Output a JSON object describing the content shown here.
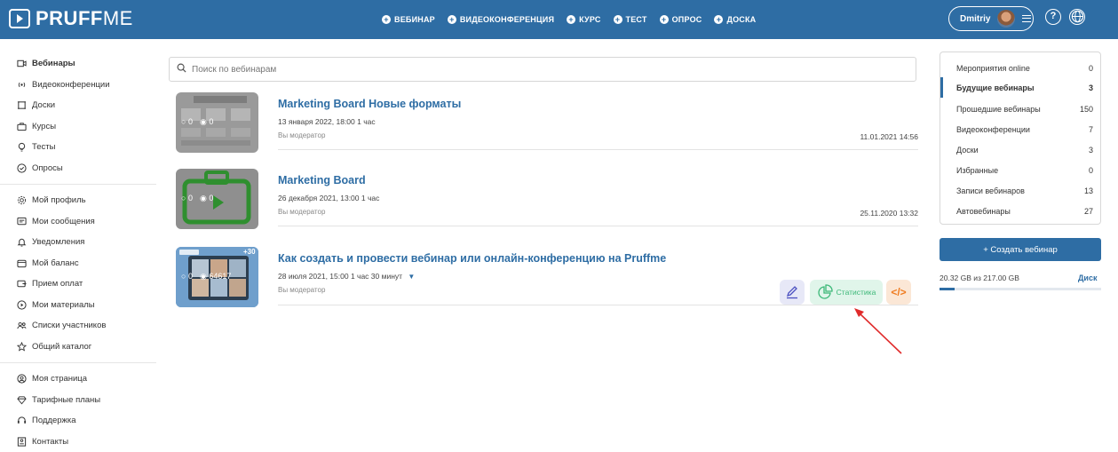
{
  "header": {
    "logo_bold": "PRUFF",
    "logo_light": "ME",
    "nav": [
      "ВЕБИНАР",
      "ВИДЕОКОНФЕРЕНЦИЯ",
      "КУРС",
      "ТЕСТ",
      "ОПРОС",
      "ДОСКА"
    ],
    "user_name": "Dmitriy",
    "help_icon": "question-circle-icon",
    "language_icon": "globe-icon"
  },
  "sidebar": {
    "group1": [
      "Вебинары",
      "Видеоконференции",
      "Доски",
      "Курсы",
      "Тесты",
      "Опросы"
    ],
    "group2": [
      "Мой профиль",
      "Мои сообщения",
      "Уведомления",
      "Мой баланс",
      "Прием оплат",
      "Мои материалы",
      "Списки участников",
      "Общий каталог"
    ],
    "group3": [
      "Моя страница",
      "Тарифные планы",
      "Поддержка",
      "Контакты"
    ]
  },
  "search": {
    "placeholder": "Поиск по вебинарам"
  },
  "webinars": [
    {
      "title": "Marketing Board Новые форматы",
      "meta": "13 января 2022, 18:00   1 час",
      "role": "Вы модератор",
      "date": "11.01.2021 14:56",
      "participants": "0",
      "views": "0"
    },
    {
      "title": "Marketing Board",
      "meta": "26 декабря 2021, 13:00   1 час",
      "role": "Вы модератор",
      "date": "25.11.2020 13:32",
      "participants": "0",
      "views": "0"
    },
    {
      "title": "Как создать и провести вебинар или онлайн-конференцию на Pruffme",
      "meta": "28 июля 2021, 15:00   1 час 30 минут",
      "role": "Вы модератор",
      "date": "",
      "participants": "0",
      "views": "64617",
      "thumb_badge": "+30",
      "stats_label": "Статистика"
    }
  ],
  "right_panel": {
    "items": [
      {
        "label": "Мероприятия online",
        "count": "0"
      },
      {
        "label": "Будущие вебинары",
        "count": "3"
      },
      {
        "label": "Прошедшие вебинары",
        "count": "150"
      },
      {
        "label": "Видеоконференции",
        "count": "7"
      },
      {
        "label": "Доски",
        "count": "3"
      },
      {
        "label": "Избранные",
        "count": "0"
      },
      {
        "label": "Записи вебинаров",
        "count": "13"
      },
      {
        "label": "Автовебинары",
        "count": "27"
      }
    ],
    "active_index": 1,
    "create_button": "+ Создать вебинар",
    "disk_usage": "20.32 GB из 217.00 GB",
    "disk_link": "Диск",
    "disk_fraction": 0.094
  },
  "colors": {
    "brand": "#2e6da4",
    "stats_bg": "#e0f5ea",
    "stats_text": "#3cb878",
    "edit_bg": "#e7e8f7",
    "embed_bg": "#fbe7d6",
    "embed_text": "#ef7b1f",
    "arrow": "#e02b2b"
  }
}
